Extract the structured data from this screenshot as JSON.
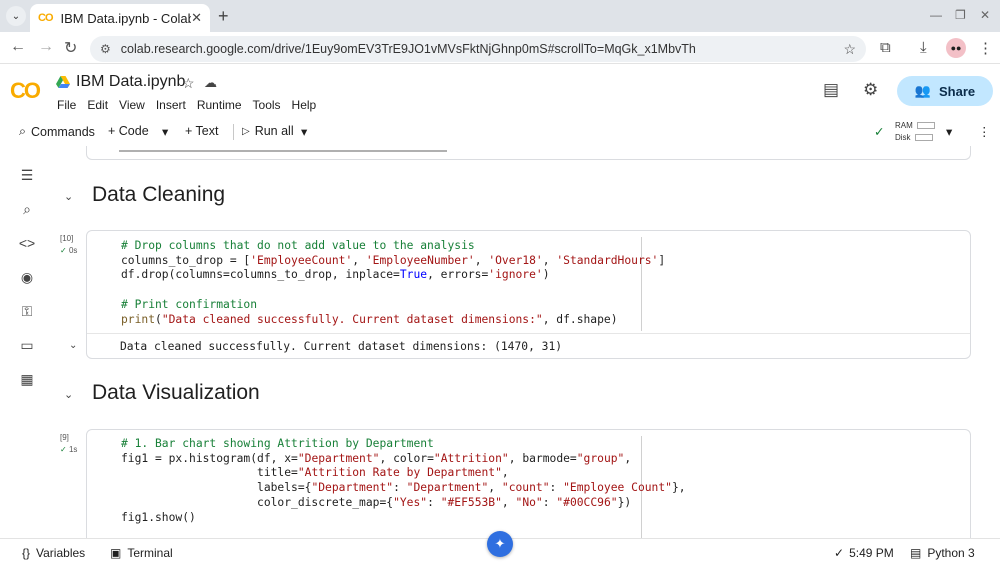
{
  "browser": {
    "tab_title": "IBM Data.ipynb - Colab",
    "favicon_text": "CO",
    "url": "colab.research.google.com/drive/1Euy9omEV3TrE9JO1vMVsFktNjGhnp0mS#scrollTo=MqGk_x1MbvTh"
  },
  "colab": {
    "logo": "CO",
    "notebook_title": "IBM Data.ipynb",
    "menu": [
      "File",
      "Edit",
      "View",
      "Insert",
      "Runtime",
      "Tools",
      "Help"
    ],
    "share_label": "Share",
    "toolbar": {
      "commands": "Commands",
      "code": "+ Code",
      "text": "+ Text",
      "run_all": "Run all",
      "ram": "RAM",
      "disk": "Disk"
    }
  },
  "sections": {
    "cleaning": "Data Cleaning",
    "visualization": "Data Visualization"
  },
  "cells": {
    "c10": {
      "count": "[10]",
      "time": "0s",
      "output": "Data cleaned successfully. Current dataset dimensions: (1470, 31)"
    },
    "c9": {
      "count": "[9]",
      "time": "1s"
    }
  },
  "statusbar": {
    "variables": "Variables",
    "terminal": "Terminal",
    "time": "5:49 PM",
    "runtime": "Python 3"
  },
  "colors": {
    "accent": "#c2e7ff",
    "logo": "#f9ab00",
    "success": "#188038"
  }
}
